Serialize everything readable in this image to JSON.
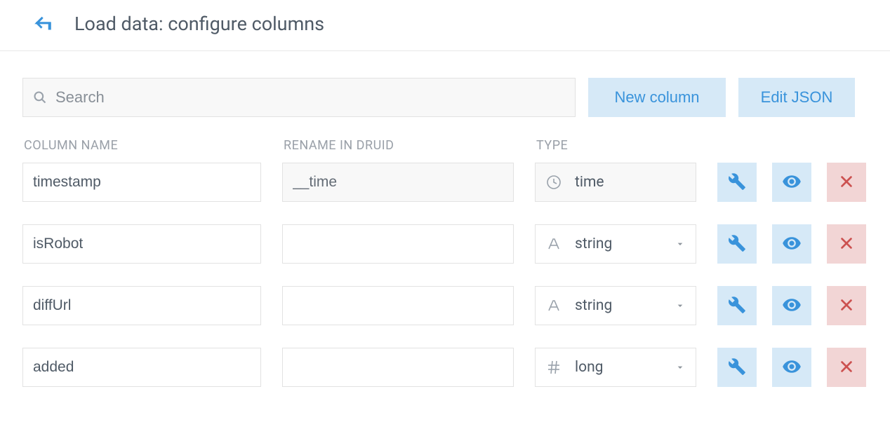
{
  "header": {
    "title": "Load data: configure columns"
  },
  "toolbar": {
    "search_placeholder": "Search",
    "new_column_label": "New column",
    "edit_json_label": "Edit JSON"
  },
  "headers": {
    "column_name": "COLUMN NAME",
    "rename": "RENAME IN DRUID",
    "type": "TYPE"
  },
  "rows": [
    {
      "name": "timestamp",
      "rename": "__time",
      "type": "time",
      "type_icon": "clock",
      "rename_readonly": true,
      "has_chevron": false
    },
    {
      "name": "isRobot",
      "rename": "",
      "type": "string",
      "type_icon": "text",
      "rename_readonly": false,
      "has_chevron": true
    },
    {
      "name": "diffUrl",
      "rename": "",
      "type": "string",
      "type_icon": "text",
      "rename_readonly": false,
      "has_chevron": true
    },
    {
      "name": "added",
      "rename": "",
      "type": "long",
      "type_icon": "hash",
      "rename_readonly": false,
      "has_chevron": true
    }
  ]
}
